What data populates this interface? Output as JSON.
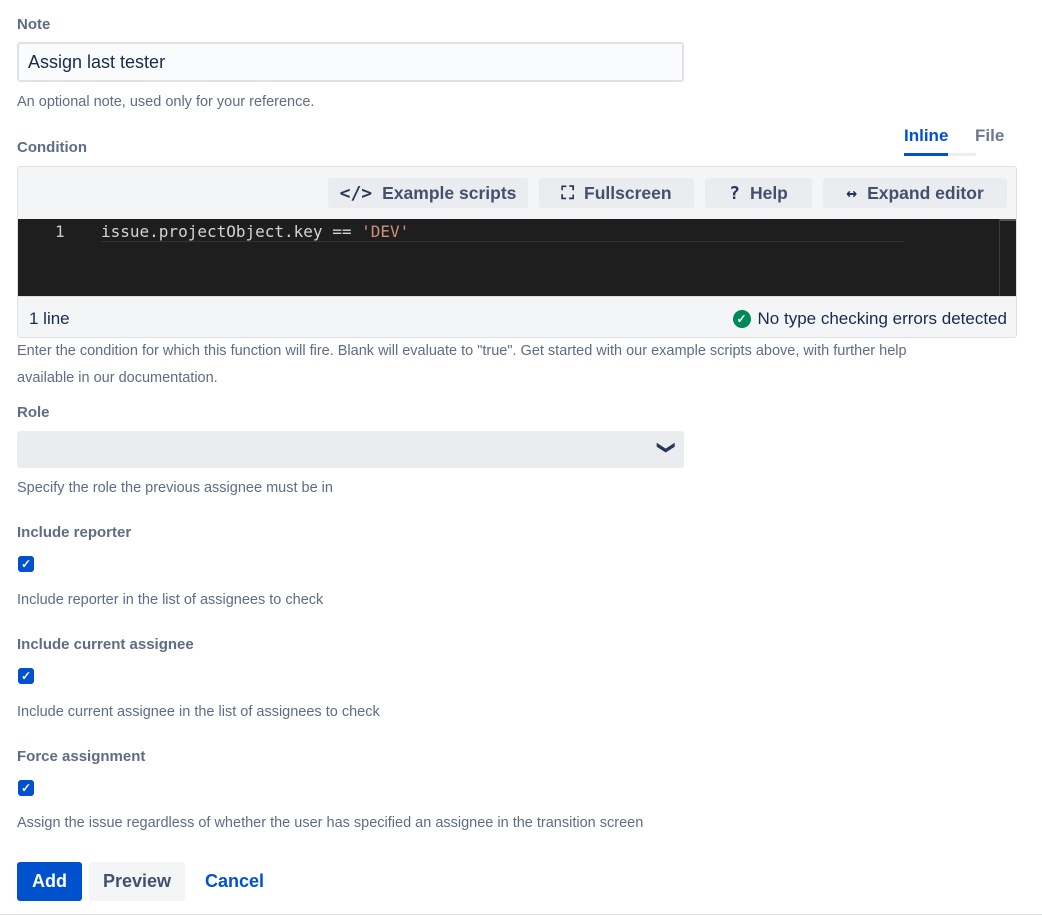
{
  "note": {
    "label": "Note",
    "value": "Assign last tester",
    "help": "An optional note, used only for your reference."
  },
  "condition": {
    "label": "Condition",
    "tabs": [
      "Inline",
      "File"
    ],
    "active_tab": "Inline",
    "toolbar": {
      "example_scripts": "Example scripts",
      "example_scripts_icon": "code-icon",
      "fullscreen": "Fullscreen",
      "fullscreen_icon": "fullscreen-icon",
      "help": "Help",
      "help_icon": "question-icon",
      "expand_editor": "Expand editor",
      "expand_editor_icon": "expand-arrows-icon"
    },
    "code": {
      "line_number": "1",
      "text_before": "issue.projectObject.key == ",
      "string_literal": "'DEV'"
    },
    "status": {
      "line_count": "1 line",
      "type_check": "No type checking errors detected"
    },
    "help": "Enter the condition for which this function will fire. Blank will evaluate to \"true\". Get started with our example scripts above, with further help",
    "help_line2": "available in our documentation."
  },
  "role": {
    "label": "Role",
    "selected": "",
    "help": "Specify the role the previous assignee must be in"
  },
  "include_reporter": {
    "label": "Include reporter",
    "checked": true,
    "help": "Include reporter in the list of assignees to check"
  },
  "include_current_assignee": {
    "label": "Include current assignee",
    "checked": true,
    "help": "Include current assignee in the list of assignees to check"
  },
  "force_assignment": {
    "label": "Force assignment",
    "checked": true,
    "help": "Assign the issue regardless of whether the user has specified an assignee in the transition screen"
  },
  "actions": {
    "add": "Add",
    "preview": "Preview",
    "cancel": "Cancel"
  },
  "colors": {
    "primary": "#0052cc",
    "success": "#00875a",
    "editor_bg": "#1e1e1e",
    "string": "#ce9178"
  }
}
